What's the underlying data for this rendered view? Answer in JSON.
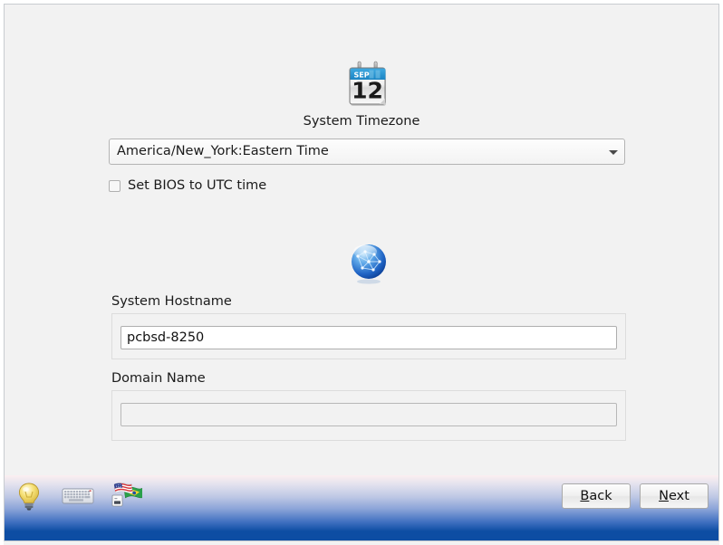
{
  "window": {
    "background_color": "#f2f2f2"
  },
  "timezone_section": {
    "icon_name": "calendar-icon",
    "calendar_month": "SEP",
    "calendar_day": "12",
    "label": "System Timezone",
    "selected_value": "America/New_York:Eastern Time",
    "dropdown_arrow_icon": "chevron-down-icon",
    "bios_checkbox_label": "Set BIOS to UTC time",
    "bios_checkbox_checked": false
  },
  "network_section": {
    "icon_name": "globe-network-icon",
    "hostname_label": "System Hostname",
    "hostname_value": "pcbsd-8250",
    "hostname_placeholder": "",
    "domain_label": "Domain Name",
    "domain_value": "",
    "domain_placeholder": ""
  },
  "bottom_bar": {
    "background_top_color": "#fbeff0",
    "background_bottom_color": "#0d4da3",
    "tray_icons": [
      {
        "name": "lightbulb-icon",
        "label": "Tips"
      },
      {
        "name": "keyboard-icon",
        "label": "Virtual Keyboard"
      },
      {
        "name": "flags-language-icon",
        "label": "Keyboard Layout"
      }
    ],
    "buttons": [
      {
        "name": "back-button",
        "mnemonic": "B",
        "rest": "ack"
      },
      {
        "name": "next-button",
        "mnemonic": "N",
        "rest": "ext"
      }
    ]
  }
}
